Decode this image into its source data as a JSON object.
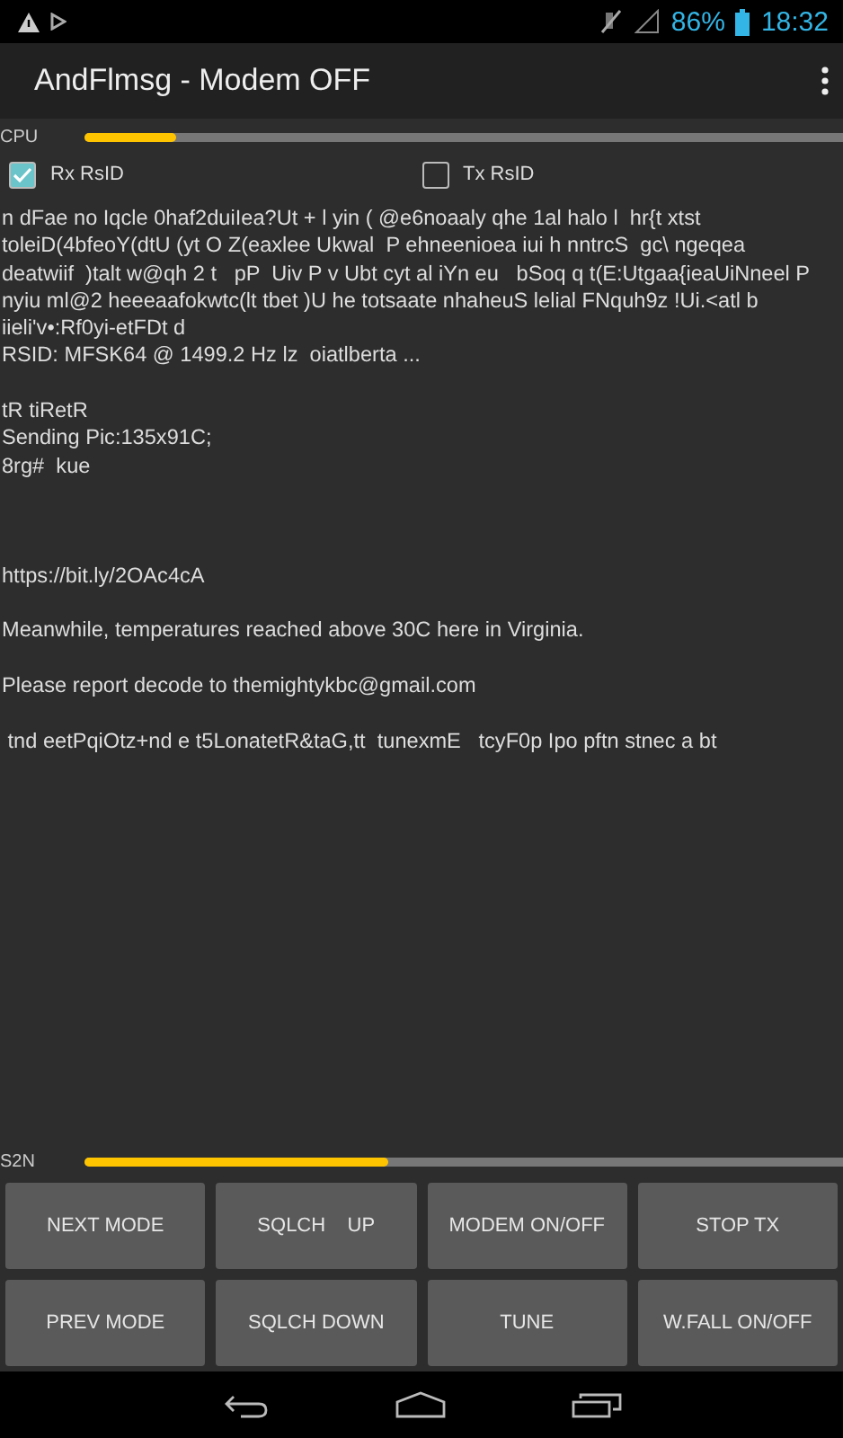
{
  "status_bar": {
    "battery": "86%",
    "time": "18:32"
  },
  "app_bar": {
    "title": "AndFlmsg - Modem OFF"
  },
  "cpu_meter": {
    "label": "CPU",
    "level": 0.12
  },
  "rsid_options": [
    {
      "label": "Rx RsID",
      "checked": true
    },
    {
      "label": "Tx RsID",
      "checked": false
    }
  ],
  "received_text": "n dFae no Iqcle 0haf2duiIea?Ut + l yin ( @e6noaaly qhe 1al halo l  hr{t xtst\ntoleiD(4bfeoY(dtU (yt O Z(eaxlee Ukwal  P ehneenioea iui h nntrcS  gc\\ ngeqea\ndeatwiif  )talt w@qh 2 t   pP  Uiv P v Ubt cyt al iYn eu   bSoq q t(E:Utgaa{ieaUiNneel P\nnyiu ml@2 heeeaafokwtc(lt tbet )U he totsaate nhaheuS lelial FNquh9z !Ui.<atl b\niieli'v•:Rf0yi-etFDt d\nRSID: MFSK64 @ 1499.2 Hz lz  oiatlberta ...\n\ntR tiRetR\nSending Pic:135x91C;\n8rg#  kue\n\n\n\nhttps://bit.ly/2OAc4cA\n\nMeanwhile, temperatures reached above 30C here in Virginia.\n\nPlease report decode to themightykbc@gmail.com\n\n tnd eetPqiOtz+nd e t5LonatetR&taG,tt  tunexmE   tcyF0p Ipo pftn stnec a bt",
  "s2n_meter": {
    "label": "S2N",
    "level": 0.4
  },
  "buttons": [
    "NEXT MODE",
    "SQLCH    UP",
    "MODEM ON/OFF",
    "STOP TX",
    "PREV MODE",
    "SQLCH DOWN",
    "TUNE",
    "W.FALL ON/OFF"
  ]
}
